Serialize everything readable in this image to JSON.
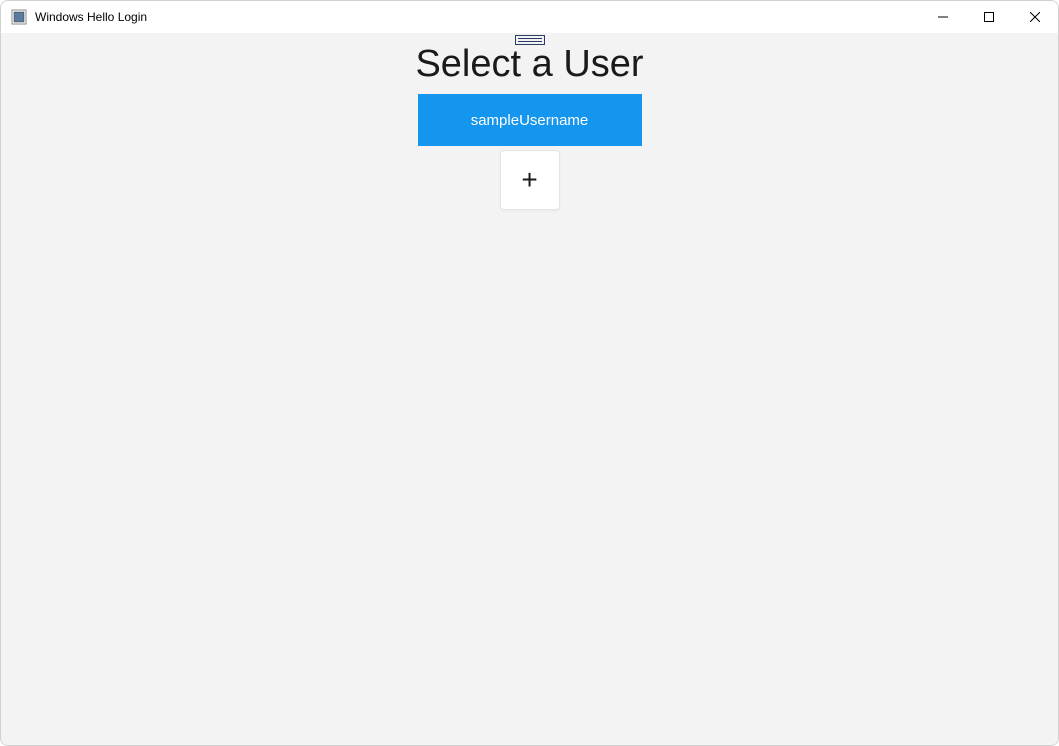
{
  "window": {
    "title": "Windows Hello Login"
  },
  "main": {
    "heading": "Select a User",
    "users": [
      {
        "label": "sampleUsername"
      }
    ],
    "add_label": "+"
  }
}
